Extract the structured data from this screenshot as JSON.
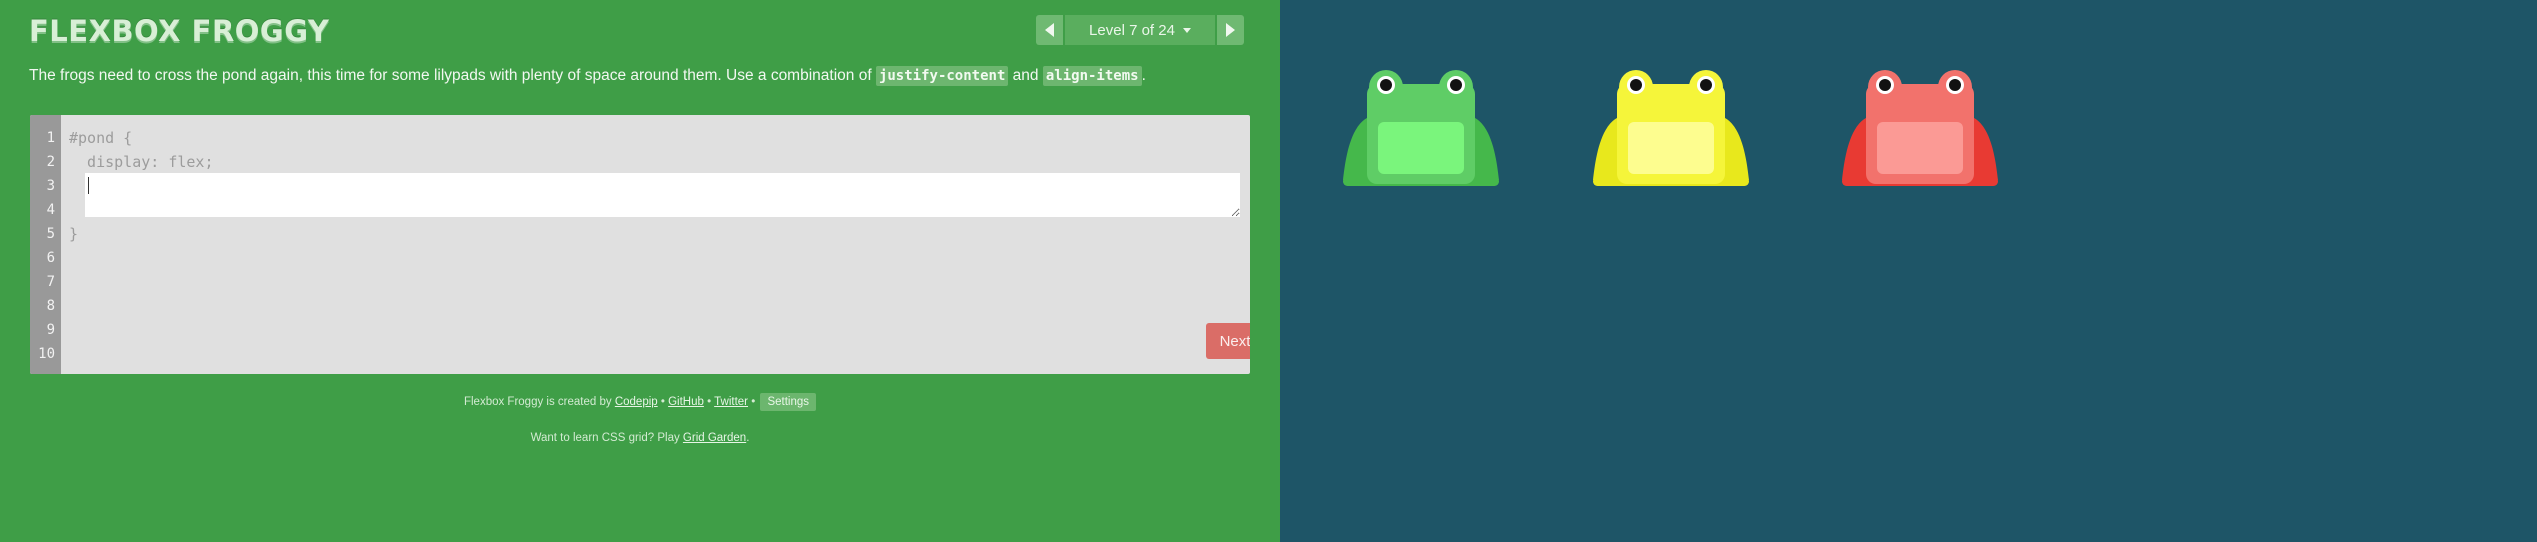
{
  "header": {
    "title": "FLEXBOX FROGGY",
    "level_label": "Level 7 of 24"
  },
  "instructions": {
    "text_before": "The frogs need to cross the pond again, this time for some lilypads with plenty of space around them. Use a combination of ",
    "kw1": "justify-content",
    "text_middle": " and ",
    "kw2": "align-items",
    "text_after": "."
  },
  "editor": {
    "line_numbers": [
      "1",
      "2",
      "3",
      "4",
      "5",
      "6",
      "7",
      "8",
      "9",
      "10"
    ],
    "line1": "#pond {",
    "line2": "  display: flex;",
    "line_close": "}",
    "input_value": "",
    "next_label": "Next"
  },
  "footer": {
    "credits_prefix": "Flexbox Froggy is created by",
    "codepip": "Codepip",
    "github": "GitHub",
    "twitter": "Twitter",
    "separator": "•",
    "settings": "Settings",
    "learn_prefix": "Want to learn CSS grid? Play",
    "grid_garden": "Grid Garden",
    "learn_suffix": "."
  },
  "board": {
    "frogs": [
      {
        "color": "green",
        "body": "#5fcd66",
        "belly": "#7af57c",
        "legs": "#45b84b"
      },
      {
        "color": "yellow",
        "body": "#f5f53a",
        "belly": "#fdfd8f",
        "legs": "#e8e81c"
      },
      {
        "color": "red",
        "body": "#f2726c",
        "belly": "#fb9a95",
        "legs": "#e83a33"
      }
    ]
  },
  "colors": {
    "sidebar": "#3f9e47",
    "pond": "#1e5567",
    "next_button": "#da6d67"
  }
}
